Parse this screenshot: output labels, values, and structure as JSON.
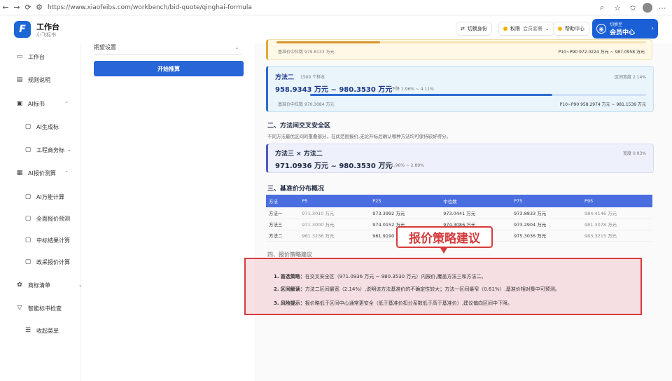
{
  "browser": {
    "url": "https://www.xiaofeibs.com/workbench/bid-quote/qinghai-formula"
  },
  "app": {
    "title": "工作台",
    "subtitle": "小飞标书"
  },
  "header": {
    "pill1": "切换身份",
    "pill2a": "权限",
    "pill2b": "会员套餐",
    "pill3": "帮助中心",
    "member_small": "切换至",
    "member_label": "会员中心"
  },
  "sidebar": {
    "items": [
      {
        "label": "工作台"
      },
      {
        "label": "规则说明"
      },
      {
        "label": "AI标书"
      },
      {
        "label": "AI生成标"
      },
      {
        "label": "工程商务标"
      },
      {
        "label": "AI报价测算"
      },
      {
        "label": "AI万能计算"
      },
      {
        "label": "全面报价预测"
      },
      {
        "label": "中标结果计算"
      },
      {
        "label": "政采报价计算"
      },
      {
        "label": "商标清单"
      },
      {
        "label": "智能标书检查"
      },
      {
        "label": "收起菜单"
      }
    ]
  },
  "form": {
    "select_label": "期望设置",
    "start_button": "开始推算"
  },
  "cards": {
    "top": {
      "median": "基准价中位数 979.8133 万元",
      "p10": "P10~P90 972.0224 万元 ~ 987.0958 万元"
    },
    "m2": {
      "name": "方法二",
      "note": "1500 个样本",
      "range": "958.9343 万元 ~ 980.3530 万元",
      "down": "下降 1.96% ~ 4.11%",
      "width_label": "区间宽度 2.14%",
      "median": "基准价中位数 970.3084 万元",
      "p10": "P10~P90 958.2974 万元 ~ 981.1539 万元",
      "fill": 0.72
    },
    "sec2_title": "二、方法间交叉安全区",
    "sec2_desc": "不同方法最优区间的重叠部分，在此范围报价,无论开标后确认哪种方法均可保持较好得分。",
    "safe": {
      "name": "方法三 × 方法二",
      "range": "971.0936 万元 ~ 980.3530 万元",
      "down": "下降 1.96% ~ 2.89%",
      "width_label": "宽度 0.93%"
    }
  },
  "sec3": {
    "title": "三、基准价分布概况",
    "headers": [
      "方法",
      "P5",
      "P25",
      "中位数",
      "P75",
      "P95"
    ],
    "rows": [
      [
        "方法一",
        "971.3010 万元",
        "973.3992 万元",
        "973.0441 万元",
        "973.8833 万元",
        "984.4146 万元"
      ],
      [
        "方法三",
        "971.3000 万元",
        "974.0152 万元",
        "974.3086 万元",
        "973.2904 万元",
        "981.3078 万元"
      ],
      [
        "方法二",
        "961.3236 万元",
        "961.9190 万元",
        "973.9086 万元",
        "975.3036 万元",
        "983.3215 万元"
      ]
    ]
  },
  "callout": "报价策略建议",
  "sec4_title": "四、报价策略建议",
  "advice": [
    {
      "no": "1.",
      "key": "首选策略：",
      "text": "在交叉安全区（971.0936 万元 ~ 980.3530 万元）内报价,覆盖方法三和方法二。"
    },
    {
      "no": "2.",
      "key": "区间解读：",
      "text": "方法二区间最宽（2.14%）,说明该方法基准价的不确定性较大；方法一区间最窄（0.61%）,基准价相对集中可预测。"
    },
    {
      "no": "3.",
      "key": "风险提示：",
      "text": "报价略低于区间中心通常更安全（低于基准价扣分系数低于高于基准价）,建议偏向区间中下限。"
    }
  ],
  "colors": {
    "accent": "#2866d8",
    "callout": "#d63b3b"
  }
}
